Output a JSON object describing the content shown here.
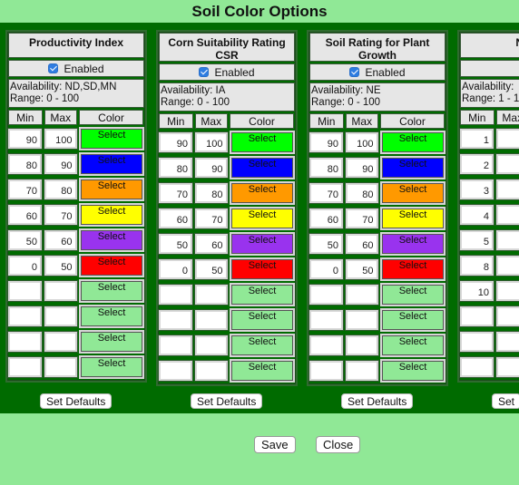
{
  "title": "Soil Color Options",
  "columns": [
    {
      "header": "Productivity Index",
      "enabled": true,
      "enabled_label": "Enabled",
      "availability": "Availability: ND,SD,MN",
      "range": "Range: 0 - 100",
      "rows": [
        {
          "min": "90",
          "max": "100",
          "color": "#00ff00"
        },
        {
          "min": "80",
          "max": "90",
          "color": "#0000ff"
        },
        {
          "min": "70",
          "max": "80",
          "color": "#ff9900"
        },
        {
          "min": "60",
          "max": "70",
          "color": "#ffff00"
        },
        {
          "min": "50",
          "max": "60",
          "color": "#9933ee"
        },
        {
          "min": "0",
          "max": "50",
          "color": "#ff0000"
        },
        {
          "min": "",
          "max": "",
          "color": "#90e896"
        },
        {
          "min": "",
          "max": "",
          "color": "#90e896"
        },
        {
          "min": "",
          "max": "",
          "color": "#90e896"
        },
        {
          "min": "",
          "max": "",
          "color": "#90e896"
        }
      ],
      "set_defaults": "Set Defaults"
    },
    {
      "header": "Corn Suitability Rating CSR",
      "enabled": true,
      "enabled_label": "Enabled",
      "availability": "Availability: IA",
      "range": "Range: 0 - 100",
      "rows": [
        {
          "min": "90",
          "max": "100",
          "color": "#00ff00"
        },
        {
          "min": "80",
          "max": "90",
          "color": "#0000ff"
        },
        {
          "min": "70",
          "max": "80",
          "color": "#ff9900"
        },
        {
          "min": "60",
          "max": "70",
          "color": "#ffff00"
        },
        {
          "min": "50",
          "max": "60",
          "color": "#9933ee"
        },
        {
          "min": "0",
          "max": "50",
          "color": "#ff0000"
        },
        {
          "min": "",
          "max": "",
          "color": "#90e896"
        },
        {
          "min": "",
          "max": "",
          "color": "#90e896"
        },
        {
          "min": "",
          "max": "",
          "color": "#90e896"
        },
        {
          "min": "",
          "max": "",
          "color": "#90e896"
        }
      ],
      "set_defaults": "Set Defaults"
    },
    {
      "header": "Soil Rating for Plant Growth",
      "enabled": true,
      "enabled_label": "Enabled",
      "availability": "Availability: NE",
      "range": "Range: 0 - 100",
      "rows": [
        {
          "min": "90",
          "max": "100",
          "color": "#00ff00"
        },
        {
          "min": "80",
          "max": "90",
          "color": "#0000ff"
        },
        {
          "min": "70",
          "max": "80",
          "color": "#ff9900"
        },
        {
          "min": "60",
          "max": "70",
          "color": "#ffff00"
        },
        {
          "min": "50",
          "max": "60",
          "color": "#9933ee"
        },
        {
          "min": "0",
          "max": "50",
          "color": "#ff0000"
        },
        {
          "min": "",
          "max": "",
          "color": "#90e896"
        },
        {
          "min": "",
          "max": "",
          "color": "#90e896"
        },
        {
          "min": "",
          "max": "",
          "color": "#90e896"
        },
        {
          "min": "",
          "max": "",
          "color": "#90e896"
        }
      ],
      "set_defaults": "Set Defaults"
    },
    {
      "header": "Non-",
      "enabled": false,
      "enabled_label": "",
      "availability": "Availability:",
      "range": "Range: 1 - 1",
      "rows": [
        {
          "min": "1",
          "max": "",
          "color": ""
        },
        {
          "min": "2",
          "max": "",
          "color": ""
        },
        {
          "min": "3",
          "max": "",
          "color": ""
        },
        {
          "min": "4",
          "max": "",
          "color": ""
        },
        {
          "min": "5",
          "max": "",
          "color": ""
        },
        {
          "min": "8",
          "max": "",
          "color": ""
        },
        {
          "min": "10",
          "max": "",
          "color": ""
        },
        {
          "min": "",
          "max": "",
          "color": ""
        },
        {
          "min": "",
          "max": "",
          "color": ""
        },
        {
          "min": "",
          "max": "",
          "color": ""
        }
      ],
      "set_defaults": "Set"
    }
  ],
  "grid_headers": {
    "min": "Min",
    "max": "Max",
    "color": "Color"
  },
  "select_label": "Select",
  "footer": {
    "save": "Save",
    "close": "Close"
  }
}
